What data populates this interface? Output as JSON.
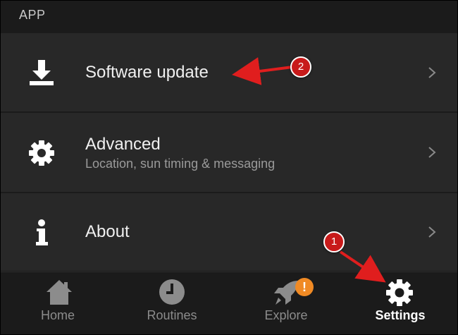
{
  "section": {
    "header": "APP"
  },
  "rows": [
    {
      "title": "Software update",
      "subtitle": "",
      "icon": "download-icon"
    },
    {
      "title": "Advanced",
      "subtitle": "Location, sun timing & messaging",
      "icon": "gear-icon"
    },
    {
      "title": "About",
      "subtitle": "",
      "icon": "info-icon"
    }
  ],
  "tabs": [
    {
      "label": "Home",
      "icon": "home-icon",
      "active": false
    },
    {
      "label": "Routines",
      "icon": "clock-icon",
      "active": false
    },
    {
      "label": "Explore",
      "icon": "rocket-icon",
      "active": false,
      "badge": "!"
    },
    {
      "label": "Settings",
      "icon": "gear-icon",
      "active": true
    }
  ],
  "annotations": [
    {
      "number": "1",
      "target": "Settings"
    },
    {
      "number": "2",
      "target": "Software update"
    }
  ],
  "colors": {
    "background": "#1b1b1b",
    "row_background": "#282828",
    "text_primary": "#f0f0f0",
    "text_secondary": "#9a9a9a",
    "tab_inactive": "#8c8c8c",
    "badge": "#f08a24",
    "annotation": "#c81a1a"
  }
}
